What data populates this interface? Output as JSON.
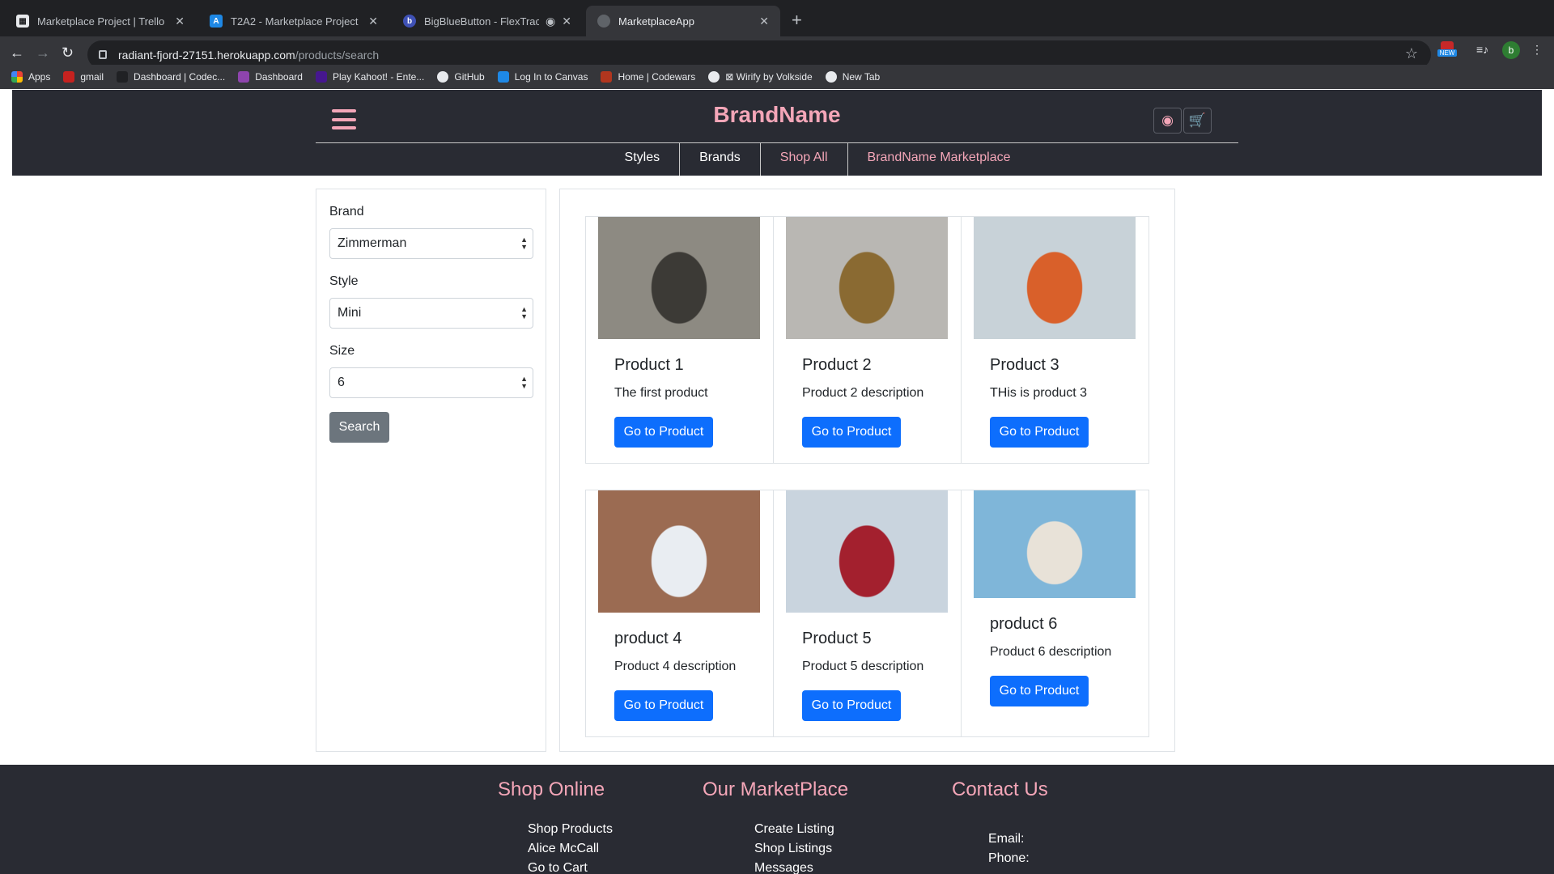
{
  "browser": {
    "tabs": [
      {
        "title": "Marketplace Project | Trello",
        "color": "#e8eaed",
        "glyph": "▦"
      },
      {
        "title": "T2A2 - Marketplace Project",
        "color": "#1e88e5",
        "glyph": "A"
      },
      {
        "title": "BigBlueButton - FlexTrack - ",
        "color": "#3f51b5",
        "glyph": "b"
      },
      {
        "title": "MarketplaceApp",
        "color": "#5f6368",
        "glyph": ""
      }
    ],
    "url_host": "radiant-fjord-27151.herokuapp.com",
    "url_path": "/products/search",
    "ext_badge": "NEW",
    "profile_initial": "b",
    "bookmarks": [
      {
        "label": "Apps",
        "color": "#ea4335"
      },
      {
        "label": "gmail",
        "color": "#c5221f"
      },
      {
        "label": "Dashboard | Codec...",
        "color": "#202124"
      },
      {
        "label": "Dashboard",
        "color": "#8e44ad"
      },
      {
        "label": "Play Kahoot! - Ente...",
        "color": "#46178f"
      },
      {
        "label": "GitHub",
        "color": "#e8eaed"
      },
      {
        "label": "Log In to Canvas",
        "color": "#1e88e5"
      },
      {
        "label": "Home | Codewars",
        "color": "#b1361e"
      },
      {
        "label": "⊠ Wirify by Volkside",
        "color": "#e8eaed"
      },
      {
        "label": "New Tab",
        "color": "#e8eaed"
      }
    ]
  },
  "header": {
    "brand": "BrandName",
    "nav": [
      "Styles",
      "Brands",
      "Shop All",
      "BrandName Marketplace"
    ]
  },
  "filter": {
    "brand_label": "Brand",
    "brand_value": "Zimmerman",
    "style_label": "Style",
    "style_value": "Mini",
    "size_label": "Size",
    "size_value": "6",
    "search_label": "Search"
  },
  "products": [
    {
      "name": "Product 1",
      "description": "The first product",
      "button": "Go to Product",
      "img_a": "#8d8a82",
      "img_b": "#3c3a36"
    },
    {
      "name": "Product 2",
      "description": "Product 2 description",
      "button": "Go to Product",
      "img_a": "#b9b7b3",
      "img_b": "#8a6a32"
    },
    {
      "name": "Product 3",
      "description": "THis is product 3",
      "button": "Go to Product",
      "img_a": "#c8d2d8",
      "img_b": "#d9602a"
    },
    {
      "name": "product 4",
      "description": "Product 4 description",
      "button": "Go to Product",
      "img_a": "#9b6b52",
      "img_b": "#e9edf2"
    },
    {
      "name": "Product 5",
      "description": "Product 5 description",
      "button": "Go to Product",
      "img_a": "#c9d4de",
      "img_b": "#a3202e"
    },
    {
      "name": "product 6",
      "description": "Product 6 description",
      "button": "Go to Product",
      "img_a": "#7fb6d9",
      "img_b": "#e8e2d8"
    }
  ],
  "footer": {
    "col1": {
      "title": "Shop Online",
      "links": [
        "Shop Products",
        "Alice McCall",
        "Go to Cart"
      ]
    },
    "col2": {
      "title": "Our MarketPlace",
      "links": [
        "Create Listing",
        "Shop Listings",
        "Messages"
      ]
    },
    "col3": {
      "title": "Contact Us",
      "links": [
        "Email:",
        "Phone:"
      ]
    }
  }
}
